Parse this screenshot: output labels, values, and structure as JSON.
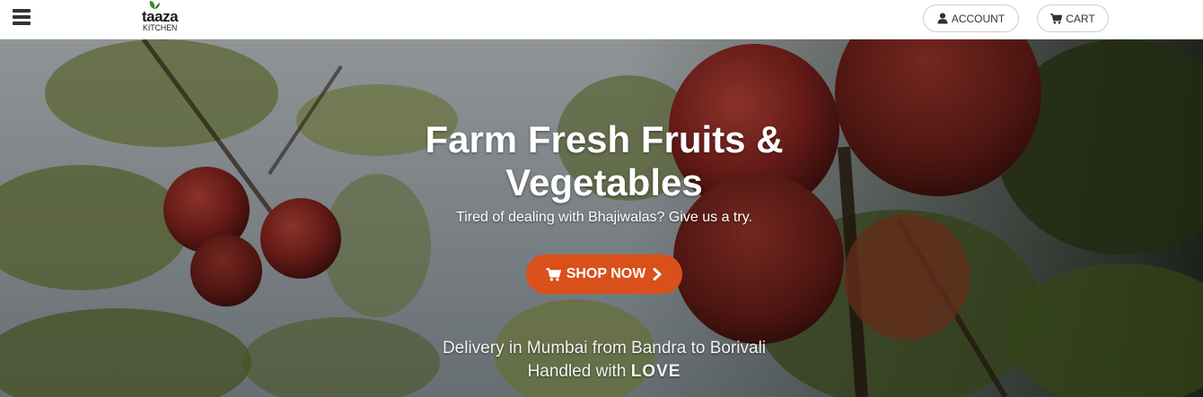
{
  "header": {
    "menu_icon": "hamburger-menu-icon",
    "logo": {
      "word": "taaza",
      "sub": "KITCHEN"
    },
    "account_label": "ACCOUNT",
    "account_icon": "user-icon",
    "cart_label": "CART",
    "cart_icon": "cart-icon"
  },
  "hero": {
    "title": "Farm Fresh Fruits & Vegetables",
    "subtitle": "Tired of dealing with Bhajiwalas? Give us a try.",
    "cta_label": "SHOP NOW",
    "cta_icon": "cart-icon",
    "cta_arrow_icon": "chevron-right-icon",
    "delivery_text": "Delivery in Mumbai from Bandra to Borivali",
    "handled_prefix": "Handled with",
    "handled_emphasis": "LOVE"
  },
  "colors": {
    "brand_orange": "#d9501a",
    "logo_green": "#3a8a2a"
  }
}
